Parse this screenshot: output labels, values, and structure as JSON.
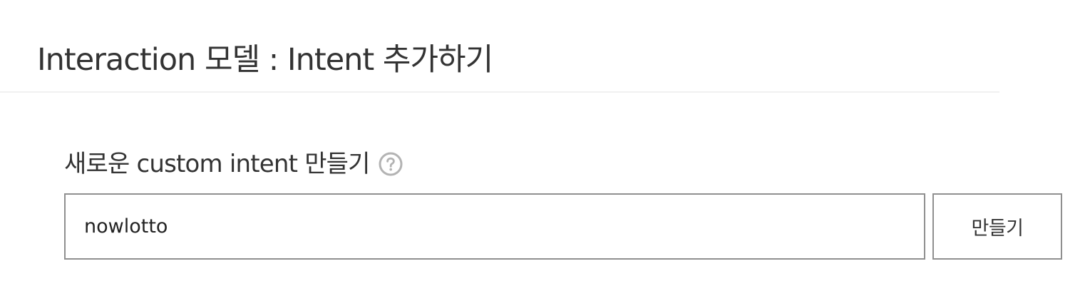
{
  "header": {
    "title": "Interaction 모델 : Intent 추가하기"
  },
  "create_section": {
    "label": "새로운 custom intent 만들기",
    "help_icon": "question-circle-icon",
    "input_value": "nowlotto",
    "button_label": "만들기"
  },
  "colors": {
    "border": "#8f8f8f",
    "divider": "#f1f1f1",
    "text": "#333333",
    "help_icon": "#b3b3b3",
    "spellcheck_underline": "#e0453a"
  }
}
